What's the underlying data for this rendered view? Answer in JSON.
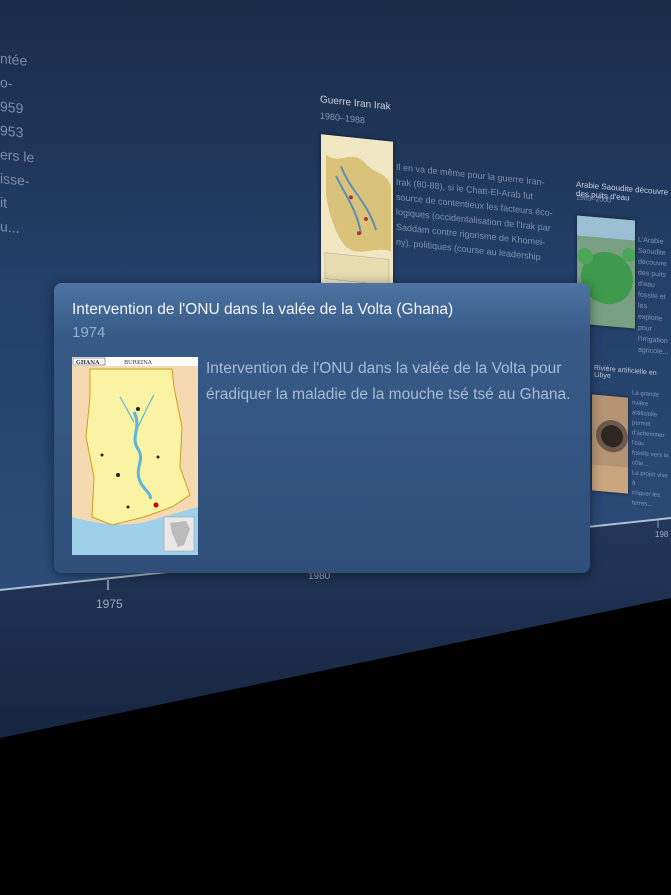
{
  "background_left_text": "ntée\no-\n959\n953\ners le\nisse-\nit\nu...",
  "event_iran_iraq": {
    "title": "Guerre Iran Irak",
    "years": "1980–1988",
    "text": "Il en va de même pour la guerre Iran-\nIrak (80-88), si le Chatt-El-Arab fut\nsource de contentieux les facteurs éco-\nlogiques (occidentalisation de l'Irak par\nSaddam contre rigorisme de Khomei-\nny), politiques (course au leadership"
  },
  "event_arabie": {
    "title": "Arabie Saoudite découvre des puits d'eau",
    "years": "1980–2000",
    "text": "L'Arabie Saoudite\ndécouvre des puits\nd'eau fossile et les\nexploite pour\nl'irrigation\nagricole..."
  },
  "event_libye": {
    "title": "Rivière artificielle en Libye",
    "text": "La grande rivière artificielle\npermet d'acheminer l'eau\nfossile vers la côte...\nLe projet vise à\nirriguer les terres..."
  },
  "axis_labels": [
    "1975",
    "1980",
    "198"
  ],
  "popover": {
    "title": "Intervention de l'ONU dans la valée de la Volta (Ghana)",
    "year": "1974",
    "description": "Intervention de l'ONU dans la valée de la Volta pour éradiquer la maladie de la mouche tsé tsé au Ghana.",
    "map_header_left": "GHANA",
    "map_header_right": "BURKINA"
  },
  "colors": {
    "wall_top": "#1d3150",
    "wall_bottom": "#294872",
    "popover_top": "#4d74a3",
    "popover_bottom": "#2f4f7a"
  }
}
